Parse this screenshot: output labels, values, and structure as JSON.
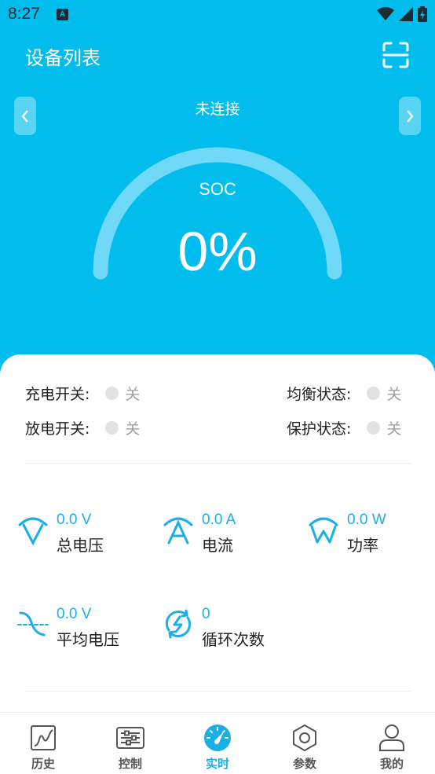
{
  "status_bar": {
    "time": "8:27",
    "app_indicator": "A"
  },
  "header": {
    "title": "设备列表",
    "scan_icon": "scan-icon"
  },
  "device": {
    "connection": "未连接",
    "prev_icon": "chevron-left-icon",
    "next_icon": "chevron-right-icon"
  },
  "gauge": {
    "label": "SOC",
    "value_text": "0%",
    "level": 0
  },
  "switches": {
    "charge": {
      "label": "充电开关:",
      "value": "关"
    },
    "balance": {
      "label": "均衡状态:",
      "value": "关"
    },
    "discharge": {
      "label": "放电开关:",
      "value": "关"
    },
    "protect": {
      "label": "保护状态:",
      "value": "关"
    }
  },
  "metrics": {
    "total_voltage": {
      "value": "0.0 V",
      "label": "总电压",
      "icon": "voltage-icon"
    },
    "current": {
      "value": "0.0 A",
      "label": "电流",
      "icon": "current-icon"
    },
    "power": {
      "value": "0.0 W",
      "label": "功率",
      "icon": "power-icon"
    },
    "avg_voltage": {
      "value": "0.0 V",
      "label": "平均电压",
      "icon": "average-voltage-icon"
    },
    "cycles": {
      "value": "0",
      "label": "循环次数",
      "icon": "cycle-icon"
    }
  },
  "tabs": [
    {
      "label": "历史",
      "icon": "history-chart-icon",
      "active": false
    },
    {
      "label": "控制",
      "icon": "sliders-icon",
      "active": false
    },
    {
      "label": "实时",
      "icon": "gauge-icon",
      "active": true
    },
    {
      "label": "参数",
      "icon": "hexagon-nut-icon",
      "active": false
    },
    {
      "label": "我的",
      "icon": "user-icon",
      "active": false
    }
  ],
  "colors": {
    "primary": "#00BDED",
    "accent": "#1AAFE6",
    "gauge_track": "#6FD9F7"
  }
}
